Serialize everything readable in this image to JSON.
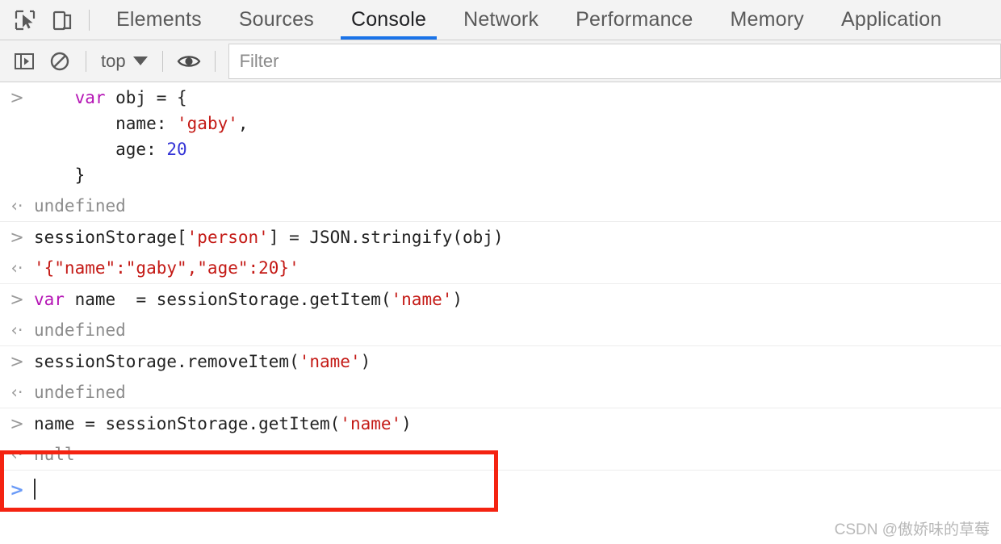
{
  "accent_color": "#1a73e8",
  "annotation_color": "#f42311",
  "toolbar": {
    "inspect_icon": "inspect-cursor-icon",
    "device_icon": "device-toolbar-icon",
    "tabs": [
      {
        "label": "Elements",
        "active": false
      },
      {
        "label": "Sources",
        "active": false
      },
      {
        "label": "Console",
        "active": true
      },
      {
        "label": "Network",
        "active": false
      },
      {
        "label": "Performance",
        "active": false
      },
      {
        "label": "Memory",
        "active": false
      },
      {
        "label": "Application",
        "active": false
      }
    ]
  },
  "console_toolbar": {
    "sidebar_icon": "console-sidebar-icon",
    "clear_icon": "clear-console-icon",
    "context": "top",
    "context_caret": "chevron-down-icon",
    "eye_icon": "live-expression-eye-icon",
    "filter_placeholder": "Filter"
  },
  "console": {
    "input_marker": ">",
    "output_marker": "‹·",
    "entries": [
      {
        "input_lines": [
          [
            {
              "t": "    ",
              "c": "plain"
            },
            {
              "t": "var",
              "c": "kw"
            },
            {
              "t": " obj = {",
              "c": "plain"
            }
          ],
          [
            {
              "t": "        name: ",
              "c": "plain"
            },
            {
              "t": "'gaby'",
              "c": "str"
            },
            {
              "t": ",",
              "c": "plain"
            }
          ],
          [
            {
              "t": "        age: ",
              "c": "plain"
            },
            {
              "t": "20",
              "c": "num"
            }
          ],
          [
            {
              "t": "    }",
              "c": "plain"
            }
          ]
        ],
        "output_lines": [
          [
            {
              "t": "undefined",
              "c": "out"
            }
          ]
        ]
      },
      {
        "input_lines": [
          [
            {
              "t": "sessionStorage[",
              "c": "plain"
            },
            {
              "t": "'person'",
              "c": "str"
            },
            {
              "t": "] = JSON.stringify(obj)",
              "c": "plain"
            }
          ]
        ],
        "output_lines": [
          [
            {
              "t": "'{\"name\":\"gaby\",\"age\":20}'",
              "c": "str"
            }
          ]
        ]
      },
      {
        "input_lines": [
          [
            {
              "t": "var",
              "c": "kw"
            },
            {
              "t": " name  = sessionStorage.getItem(",
              "c": "plain"
            },
            {
              "t": "'name'",
              "c": "str"
            },
            {
              "t": ")",
              "c": "plain"
            }
          ]
        ],
        "output_lines": [
          [
            {
              "t": "undefined",
              "c": "out"
            }
          ]
        ]
      },
      {
        "input_lines": [
          [
            {
              "t": "sessionStorage.removeItem(",
              "c": "plain"
            },
            {
              "t": "'name'",
              "c": "str"
            },
            {
              "t": ")",
              "c": "plain"
            }
          ]
        ],
        "output_lines": [
          [
            {
              "t": "undefined",
              "c": "out"
            }
          ]
        ]
      },
      {
        "highlighted": true,
        "input_lines": [
          [
            {
              "t": "name = sessionStorage.getItem(",
              "c": "plain"
            },
            {
              "t": "'name'",
              "c": "str"
            },
            {
              "t": ")",
              "c": "plain"
            }
          ]
        ],
        "output_lines": [
          [
            {
              "t": "null",
              "c": "out"
            }
          ]
        ]
      }
    ],
    "prompt_marker": ">",
    "prompt_value": ""
  },
  "watermark": "CSDN @傲娇味的草莓"
}
